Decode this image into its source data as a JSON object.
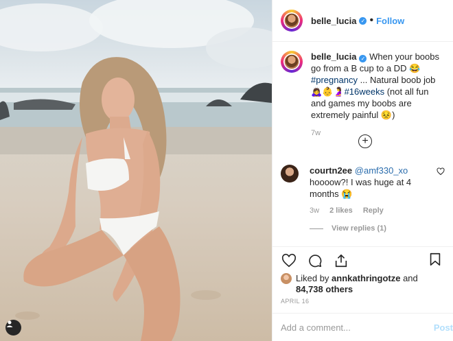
{
  "post": {
    "username": "belle_lucia",
    "verified": true,
    "follow_label": "Follow",
    "separator": "•",
    "caption": {
      "text_1": "When your boobs go from a B cup to a DD 😂 ",
      "hashtag_1": "#pregnancy",
      "text_2": " ... Natural boob job 🙇‍♀️👶🤰",
      "hashtag_2": "#16weeks",
      "text_3": " (not all fun and games my boobs are extremely painful 😣)",
      "age": "7w"
    },
    "load_more_icon": "plus-circle-icon",
    "comment": {
      "username": "courtn2ee",
      "mention": "@amf330_xo",
      "text": " hoooow?! I was huge at 4 months 😭",
      "age": "3w",
      "likes": "2 likes",
      "reply_label": "Reply",
      "view_replies": "View replies (1)"
    },
    "likes": {
      "prefix": "Liked by ",
      "user": "annkathringotze",
      "middle": " and ",
      "count": "84,738 others"
    },
    "date": "APRIL 16",
    "add_comment_placeholder": "Add a comment...",
    "post_label": "Post"
  },
  "colors": {
    "accent": "#3897f0",
    "hashtag": "#003569",
    "muted": "#999999",
    "post_disabled": "#b2dffc"
  }
}
